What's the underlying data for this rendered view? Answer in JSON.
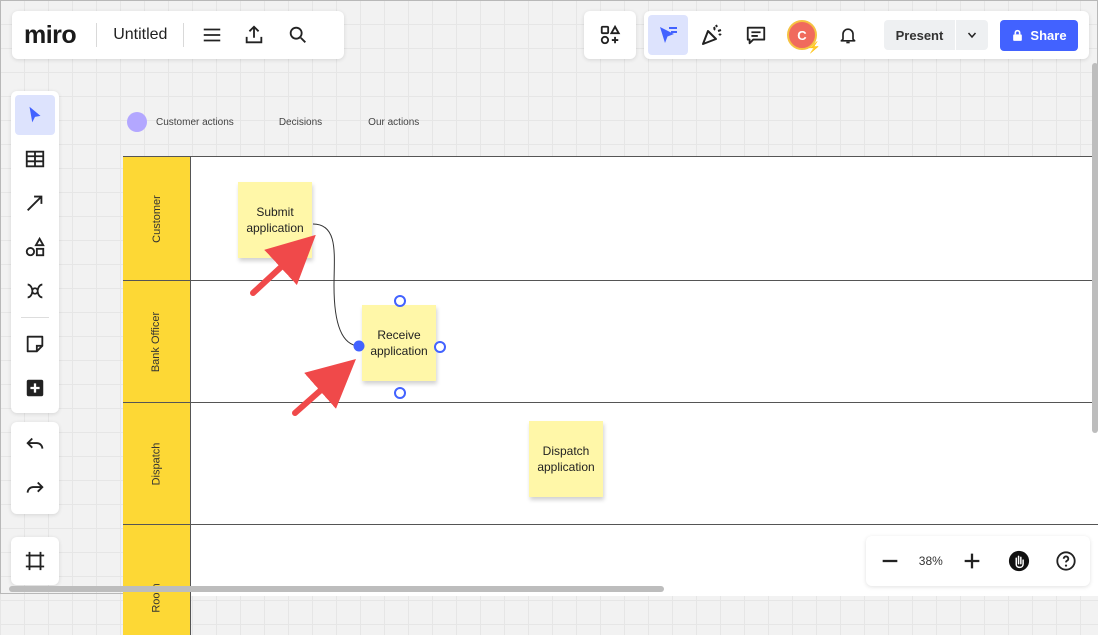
{
  "app": {
    "logo": "miro",
    "board_title": "Untitled"
  },
  "topbar": {
    "present_label": "Present",
    "share_label": "Share",
    "avatar_initial": "C"
  },
  "legend": {
    "items": [
      "Customer actions",
      "Decisions",
      "Our actions"
    ],
    "dot_color": "#b3a7ff"
  },
  "swimlane": {
    "lanes": [
      "Customer",
      "Bank Officer",
      "Dispatch",
      "Room"
    ],
    "lane_color": "#fdd835"
  },
  "stickies": [
    {
      "lines": [
        "Submit",
        "application"
      ]
    },
    {
      "lines": [
        "Receive",
        "application"
      ]
    },
    {
      "lines": [
        "Dispatch",
        "application"
      ]
    }
  ],
  "zoom": {
    "level": "38%"
  },
  "colors": {
    "accent": "#4262ff",
    "sticky": "#fff7a8",
    "annotation_arrow": "#f0494a"
  }
}
